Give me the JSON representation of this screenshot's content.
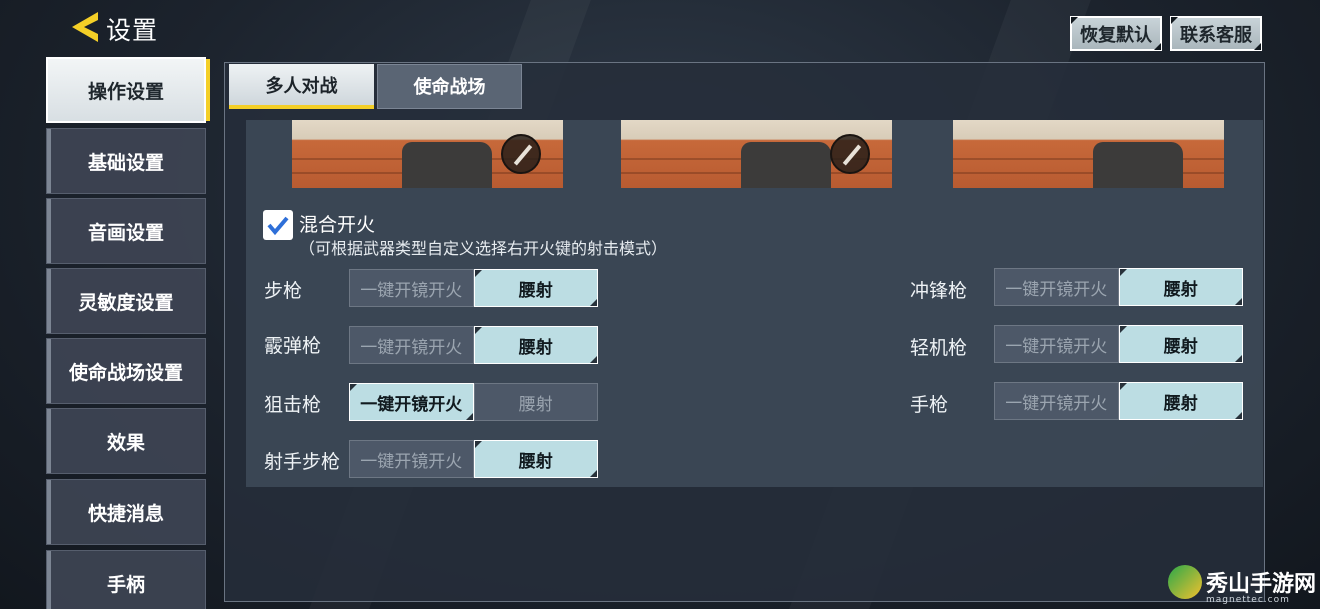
{
  "header": {
    "title": "设置",
    "restore_default": "恢复默认",
    "contact_support": "联系客服"
  },
  "sidebar": {
    "items": [
      {
        "label": "操作设置",
        "active": true
      },
      {
        "label": "基础设置"
      },
      {
        "label": "音画设置"
      },
      {
        "label": "灵敏度设置"
      },
      {
        "label": "使命战场设置"
      },
      {
        "label": "效果"
      },
      {
        "label": "快捷消息"
      },
      {
        "label": "手柄"
      }
    ]
  },
  "tabs": [
    {
      "label": "多人对战",
      "active": true
    },
    {
      "label": "使命战场",
      "active": false
    }
  ],
  "mixed_fire": {
    "checked": true,
    "label": "混合开火",
    "description": "（可根据武器类型自定义选择右开火键的射击模式）"
  },
  "fire_modes": {
    "option_a": "一键开镜开火",
    "option_b": "腰射"
  },
  "weapons_left": [
    {
      "name": "步枪",
      "selected": "腰射"
    },
    {
      "name": "霰弹枪",
      "selected": "腰射"
    },
    {
      "name": "狙击枪",
      "selected": "一键开镜开火"
    },
    {
      "name": "射手步枪",
      "selected": "腰射"
    }
  ],
  "weapons_right": [
    {
      "name": "冲锋枪",
      "selected": "腰射"
    },
    {
      "name": "轻机枪",
      "selected": "腰射"
    },
    {
      "name": "手枪",
      "selected": "腰射"
    }
  ],
  "watermark": {
    "brand": "秀山手游网",
    "domain": "magnettec.com"
  },
  "colors": {
    "accent": "#f4cf27",
    "selected_option": "#bcdde3"
  }
}
